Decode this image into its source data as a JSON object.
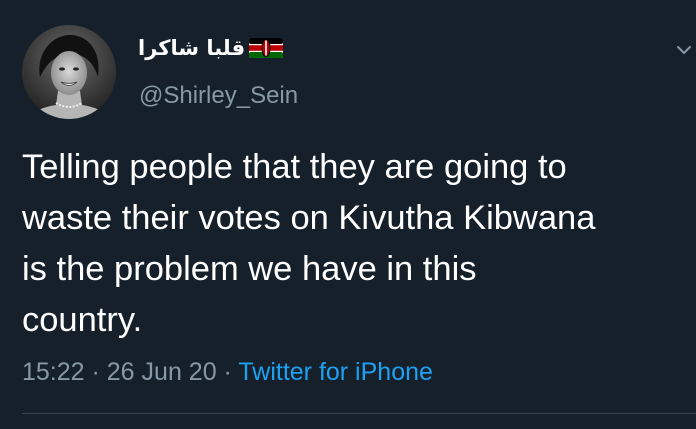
{
  "tweet": {
    "display_name": "قلبا شاكرا",
    "handle": "@Shirley_Sein",
    "text": "Telling people that they are going to\nwaste their votes on Kivutha Kibwana\nis the problem we have in this\ncountry.",
    "time": "15:22",
    "separator_1": " · ",
    "date": "26 Jun 20",
    "separator_2": " · ",
    "source": "Twitter for iPhone"
  },
  "icons": {
    "flag": "kenya-flag-emoji",
    "menu": "chevron-down-icon",
    "avatar": "profile-photo"
  },
  "colors": {
    "background": "#15202b",
    "primary_text": "#ffffff",
    "secondary_text": "#8899a6",
    "link": "#1da1f2",
    "divider": "#38444d"
  }
}
